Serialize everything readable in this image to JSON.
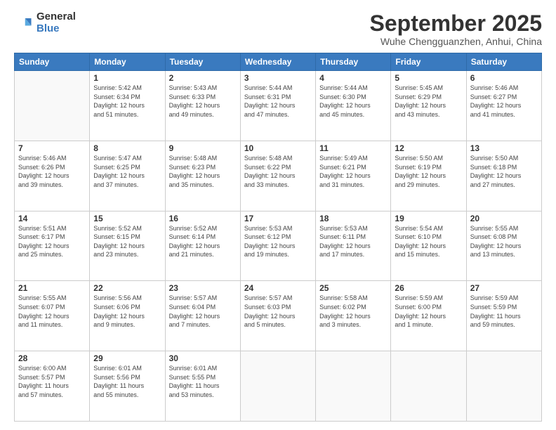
{
  "logo": {
    "general": "General",
    "blue": "Blue"
  },
  "header": {
    "month": "September 2025",
    "location": "Wuhe Chengguanzhen, Anhui, China"
  },
  "weekdays": [
    "Sunday",
    "Monday",
    "Tuesday",
    "Wednesday",
    "Thursday",
    "Friday",
    "Saturday"
  ],
  "weeks": [
    [
      {
        "day": "",
        "info": ""
      },
      {
        "day": "1",
        "info": "Sunrise: 5:42 AM\nSunset: 6:34 PM\nDaylight: 12 hours\nand 51 minutes."
      },
      {
        "day": "2",
        "info": "Sunrise: 5:43 AM\nSunset: 6:33 PM\nDaylight: 12 hours\nand 49 minutes."
      },
      {
        "day": "3",
        "info": "Sunrise: 5:44 AM\nSunset: 6:31 PM\nDaylight: 12 hours\nand 47 minutes."
      },
      {
        "day": "4",
        "info": "Sunrise: 5:44 AM\nSunset: 6:30 PM\nDaylight: 12 hours\nand 45 minutes."
      },
      {
        "day": "5",
        "info": "Sunrise: 5:45 AM\nSunset: 6:29 PM\nDaylight: 12 hours\nand 43 minutes."
      },
      {
        "day": "6",
        "info": "Sunrise: 5:46 AM\nSunset: 6:27 PM\nDaylight: 12 hours\nand 41 minutes."
      }
    ],
    [
      {
        "day": "7",
        "info": "Sunrise: 5:46 AM\nSunset: 6:26 PM\nDaylight: 12 hours\nand 39 minutes."
      },
      {
        "day": "8",
        "info": "Sunrise: 5:47 AM\nSunset: 6:25 PM\nDaylight: 12 hours\nand 37 minutes."
      },
      {
        "day": "9",
        "info": "Sunrise: 5:48 AM\nSunset: 6:23 PM\nDaylight: 12 hours\nand 35 minutes."
      },
      {
        "day": "10",
        "info": "Sunrise: 5:48 AM\nSunset: 6:22 PM\nDaylight: 12 hours\nand 33 minutes."
      },
      {
        "day": "11",
        "info": "Sunrise: 5:49 AM\nSunset: 6:21 PM\nDaylight: 12 hours\nand 31 minutes."
      },
      {
        "day": "12",
        "info": "Sunrise: 5:50 AM\nSunset: 6:19 PM\nDaylight: 12 hours\nand 29 minutes."
      },
      {
        "day": "13",
        "info": "Sunrise: 5:50 AM\nSunset: 6:18 PM\nDaylight: 12 hours\nand 27 minutes."
      }
    ],
    [
      {
        "day": "14",
        "info": "Sunrise: 5:51 AM\nSunset: 6:17 PM\nDaylight: 12 hours\nand 25 minutes."
      },
      {
        "day": "15",
        "info": "Sunrise: 5:52 AM\nSunset: 6:15 PM\nDaylight: 12 hours\nand 23 minutes."
      },
      {
        "day": "16",
        "info": "Sunrise: 5:52 AM\nSunset: 6:14 PM\nDaylight: 12 hours\nand 21 minutes."
      },
      {
        "day": "17",
        "info": "Sunrise: 5:53 AM\nSunset: 6:12 PM\nDaylight: 12 hours\nand 19 minutes."
      },
      {
        "day": "18",
        "info": "Sunrise: 5:53 AM\nSunset: 6:11 PM\nDaylight: 12 hours\nand 17 minutes."
      },
      {
        "day": "19",
        "info": "Sunrise: 5:54 AM\nSunset: 6:10 PM\nDaylight: 12 hours\nand 15 minutes."
      },
      {
        "day": "20",
        "info": "Sunrise: 5:55 AM\nSunset: 6:08 PM\nDaylight: 12 hours\nand 13 minutes."
      }
    ],
    [
      {
        "day": "21",
        "info": "Sunrise: 5:55 AM\nSunset: 6:07 PM\nDaylight: 12 hours\nand 11 minutes."
      },
      {
        "day": "22",
        "info": "Sunrise: 5:56 AM\nSunset: 6:06 PM\nDaylight: 12 hours\nand 9 minutes."
      },
      {
        "day": "23",
        "info": "Sunrise: 5:57 AM\nSunset: 6:04 PM\nDaylight: 12 hours\nand 7 minutes."
      },
      {
        "day": "24",
        "info": "Sunrise: 5:57 AM\nSunset: 6:03 PM\nDaylight: 12 hours\nand 5 minutes."
      },
      {
        "day": "25",
        "info": "Sunrise: 5:58 AM\nSunset: 6:02 PM\nDaylight: 12 hours\nand 3 minutes."
      },
      {
        "day": "26",
        "info": "Sunrise: 5:59 AM\nSunset: 6:00 PM\nDaylight: 12 hours\nand 1 minute."
      },
      {
        "day": "27",
        "info": "Sunrise: 5:59 AM\nSunset: 5:59 PM\nDaylight: 11 hours\nand 59 minutes."
      }
    ],
    [
      {
        "day": "28",
        "info": "Sunrise: 6:00 AM\nSunset: 5:57 PM\nDaylight: 11 hours\nand 57 minutes."
      },
      {
        "day": "29",
        "info": "Sunrise: 6:01 AM\nSunset: 5:56 PM\nDaylight: 11 hours\nand 55 minutes."
      },
      {
        "day": "30",
        "info": "Sunrise: 6:01 AM\nSunset: 5:55 PM\nDaylight: 11 hours\nand 53 minutes."
      },
      {
        "day": "",
        "info": ""
      },
      {
        "day": "",
        "info": ""
      },
      {
        "day": "",
        "info": ""
      },
      {
        "day": "",
        "info": ""
      }
    ]
  ]
}
